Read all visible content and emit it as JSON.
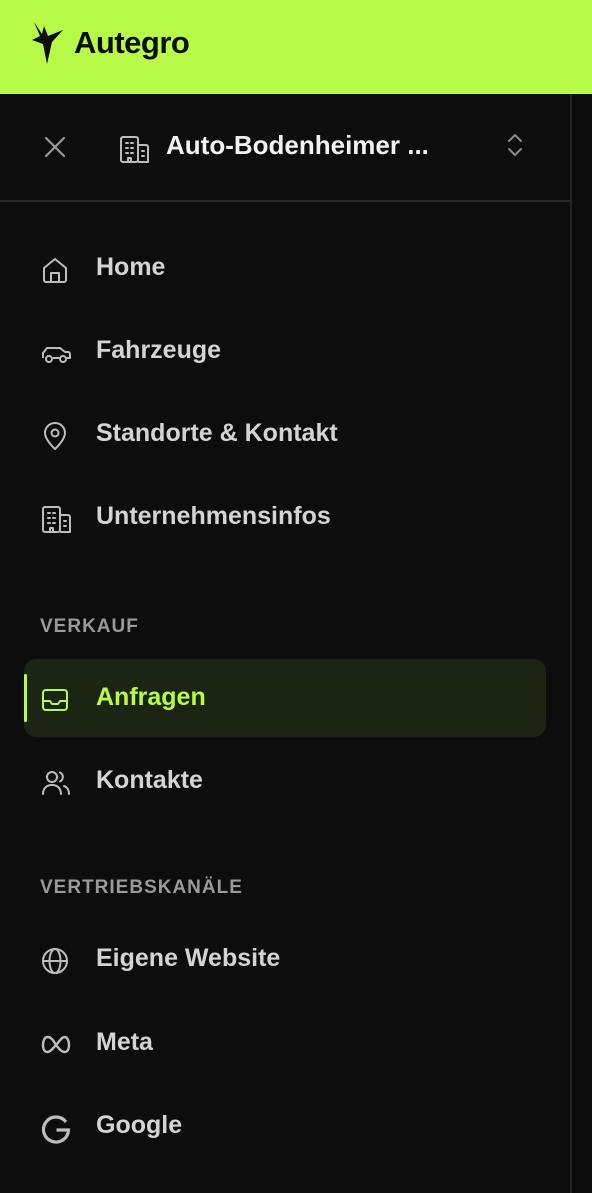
{
  "brand": {
    "name": "Autegro",
    "accent_color": "#b7fb48"
  },
  "account": {
    "name": "Auto-Bodenheimer ...",
    "icon": "building-icon",
    "switch_icon": "chevrons-up-down-icon",
    "close_icon": "close-icon"
  },
  "nav": {
    "main": [
      {
        "label": "Home",
        "icon": "home-icon"
      },
      {
        "label": "Fahrzeuge",
        "icon": "car-icon"
      },
      {
        "label": "Standorte & Kontakt",
        "icon": "map-pin-icon"
      },
      {
        "label": "Unternehmensinfos",
        "icon": "building-icon"
      }
    ],
    "sales": {
      "heading": "VERKAUF",
      "items": [
        {
          "label": "Anfragen",
          "icon": "inbox-icon",
          "active": true
        },
        {
          "label": "Kontakte",
          "icon": "users-icon",
          "active": false
        }
      ]
    },
    "channels": {
      "heading": "VERTRIEBSKANÄLE",
      "items": [
        {
          "label": "Eigene Website",
          "icon": "globe-icon"
        },
        {
          "label": "Meta",
          "icon": "meta-icon"
        },
        {
          "label": "Google",
          "icon": "google-icon"
        }
      ]
    }
  }
}
